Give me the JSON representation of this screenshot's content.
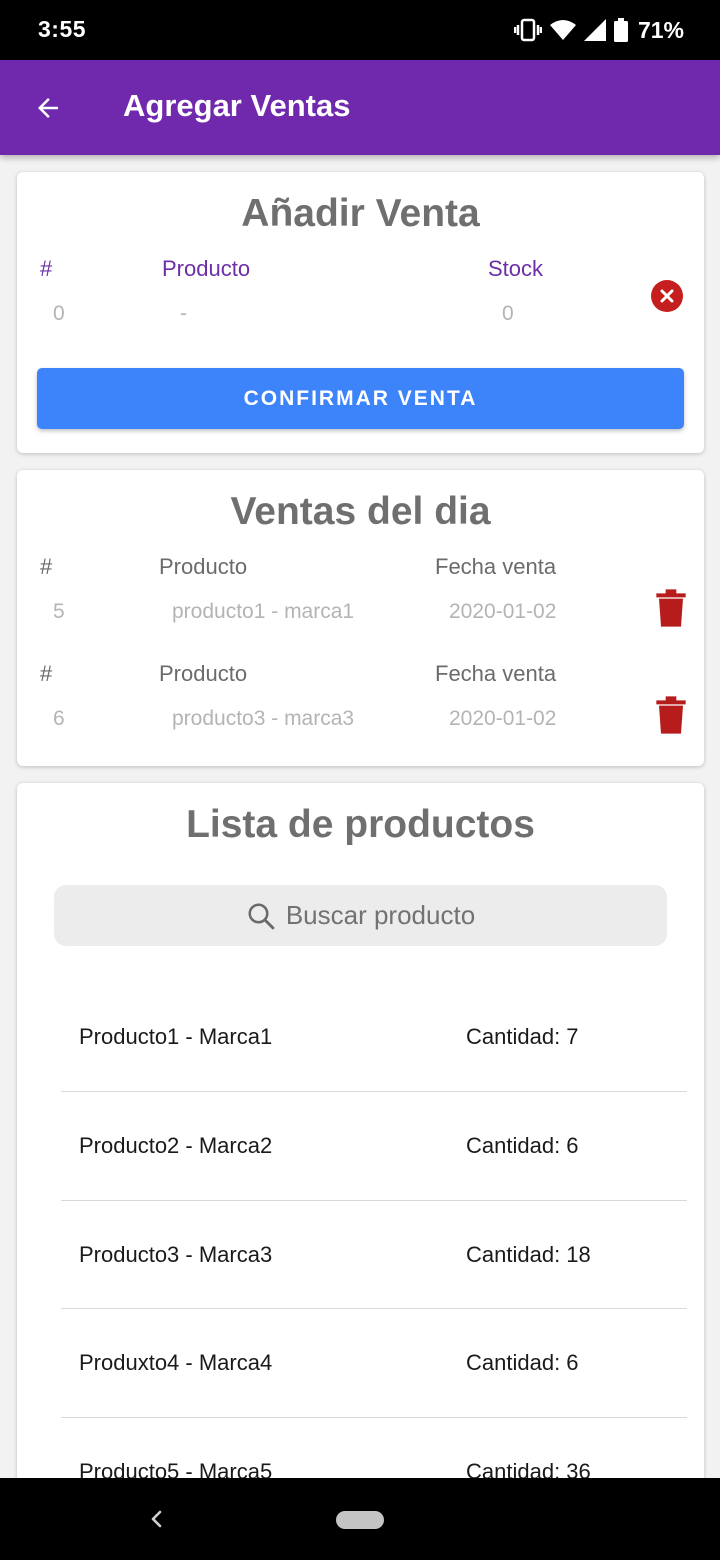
{
  "status_bar": {
    "time": "3:55",
    "battery": "71%",
    "icons": [
      "vibrate-icon",
      "wifi-icon",
      "signal-icon",
      "battery-icon"
    ]
  },
  "app_bar": {
    "title": "Agregar Ventas",
    "back_icon": "arrow-back-icon",
    "color": "#7028ad"
  },
  "add_sale": {
    "title": "Añadir Venta",
    "headers": {
      "number": "#",
      "product": "Producto",
      "stock": "Stock"
    },
    "row": {
      "number": "0",
      "product": "-",
      "stock": "0"
    },
    "remove_icon": "cancel-icon",
    "confirm_label": "CONFIRMAR VENTA",
    "confirm_color": "#3d83fa"
  },
  "daily_sales": {
    "title": "Ventas del dia",
    "entries": [
      {
        "number_header": "#",
        "product_header": "Producto",
        "date_header": "Fecha venta",
        "number": "5",
        "product": "producto1 - marca1",
        "date": "2020-01-02"
      },
      {
        "number_header": "#",
        "product_header": "Producto",
        "date_header": "Fecha venta",
        "number": "6",
        "product": "producto3 - marca3",
        "date": "2020-01-02"
      }
    ],
    "delete_icon": "trash-icon",
    "delete_color": "#b71c1c"
  },
  "product_list": {
    "title": "Lista de productos",
    "search_placeholder": "Buscar producto",
    "search_icon": "search-icon",
    "items": [
      {
        "name": "Producto1 - Marca1",
        "quantity": "Cantidad: 7"
      },
      {
        "name": "Producto2 - Marca2",
        "quantity": "Cantidad: 6"
      },
      {
        "name": "Producto3 - Marca3",
        "quantity": "Cantidad: 18"
      },
      {
        "name": "Produxto4 - Marca4",
        "quantity": "Cantidad: 6"
      },
      {
        "name": "Producto5 - Marca5",
        "quantity": "Cantidad: 36"
      }
    ]
  },
  "nav_bar": {
    "back_icon": "nav-back-icon",
    "home_icon": "home-pill-icon"
  }
}
